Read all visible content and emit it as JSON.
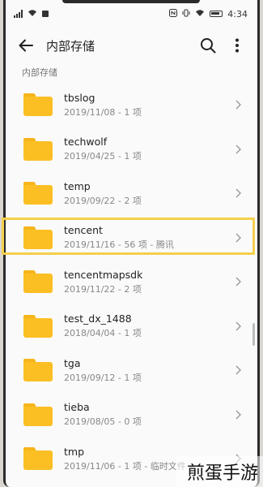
{
  "status_bar": {
    "time": "4:34"
  },
  "app_bar": {
    "title": "内部存储"
  },
  "breadcrumb": "内部存储",
  "folders": [
    {
      "name": "tbslog",
      "info": "2019/11/08 - 1 项"
    },
    {
      "name": "techwolf",
      "info": "2019/04/25 - 1 项"
    },
    {
      "name": "temp",
      "info": "2019/09/22 - 2 项"
    },
    {
      "name": "tencent",
      "info": "2019/11/16 - 56 项 - 腾讯"
    },
    {
      "name": "tencentmapsdk",
      "info": "2019/11/22 - 2 项"
    },
    {
      "name": "test_dx_1488",
      "info": "2018/04/04 - 1 项"
    },
    {
      "name": "tga",
      "info": "2019/09/12 - 1 项"
    },
    {
      "name": "tieba",
      "info": "2019/08/05 - 0 项"
    },
    {
      "name": "tmp",
      "info": "2019/11/06 - 1 项 - 临时文件"
    }
  ],
  "watermark": "煎蛋手游",
  "colors": {
    "folder": "#fbbf24",
    "highlight": "#f5cf4d"
  }
}
